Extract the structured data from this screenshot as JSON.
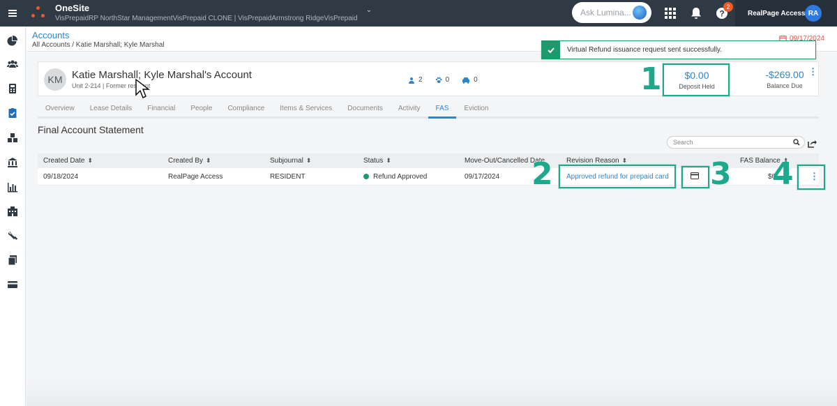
{
  "topbar": {
    "app_name": "OneSite",
    "app_path": "VisPrepaidRP NorthStar ManagementVisPrepaid CLONE | VisPrepaidArmstrong RidgeVisPrepaid",
    "ask_placeholder": "Ask Lumina...",
    "help_badge": "2",
    "user_name": "RealPage Access",
    "user_initials": "RA"
  },
  "header": {
    "title": "Accounts",
    "breadcrumb": "All Accounts / Katie Marshall; Kyle Marshal",
    "date": "09/17/2024"
  },
  "toast": {
    "message": "Virtual Refund issuance request sent successfully."
  },
  "account": {
    "initials": "KM",
    "name": "Katie Marshall; Kyle Marshal's Account",
    "unit": "Unit 2-214",
    "status": "Former resident",
    "counts": {
      "residents": "2",
      "pets": "0",
      "vehicles": "0"
    },
    "deposit_amount": "$0.00",
    "deposit_label": "Deposit Held",
    "balance_amount": "-$269.00",
    "balance_label": "Balance Due"
  },
  "tabs": [
    "Overview",
    "Lease Details",
    "Financial",
    "People",
    "Compliance",
    "Items & Services",
    "Documents",
    "Activity",
    "FAS",
    "Eviction"
  ],
  "active_tab": "FAS",
  "section_title": "Final Account Statement",
  "search_placeholder": "Search",
  "table": {
    "headers": [
      "Created Date",
      "Created By",
      "Subjournal",
      "Status",
      "Move-Out/Cancelled Date",
      "Revision Reason",
      "FAS Balance"
    ],
    "row": {
      "created_date": "09/18/2024",
      "created_by": "RealPage Access",
      "subjournal": "RESIDENT",
      "status": "Refund Approved",
      "move_out": "09/17/2024",
      "revision_reason": "Approved refund for prepaid card",
      "fas_balance": "$0"
    }
  },
  "annotations": [
    "1",
    "2",
    "3",
    "4"
  ],
  "colors": {
    "accent": "#2e86c8",
    "callout": "#1fa98c",
    "success": "#1c9a6b",
    "topbar": "#2f3a44"
  }
}
